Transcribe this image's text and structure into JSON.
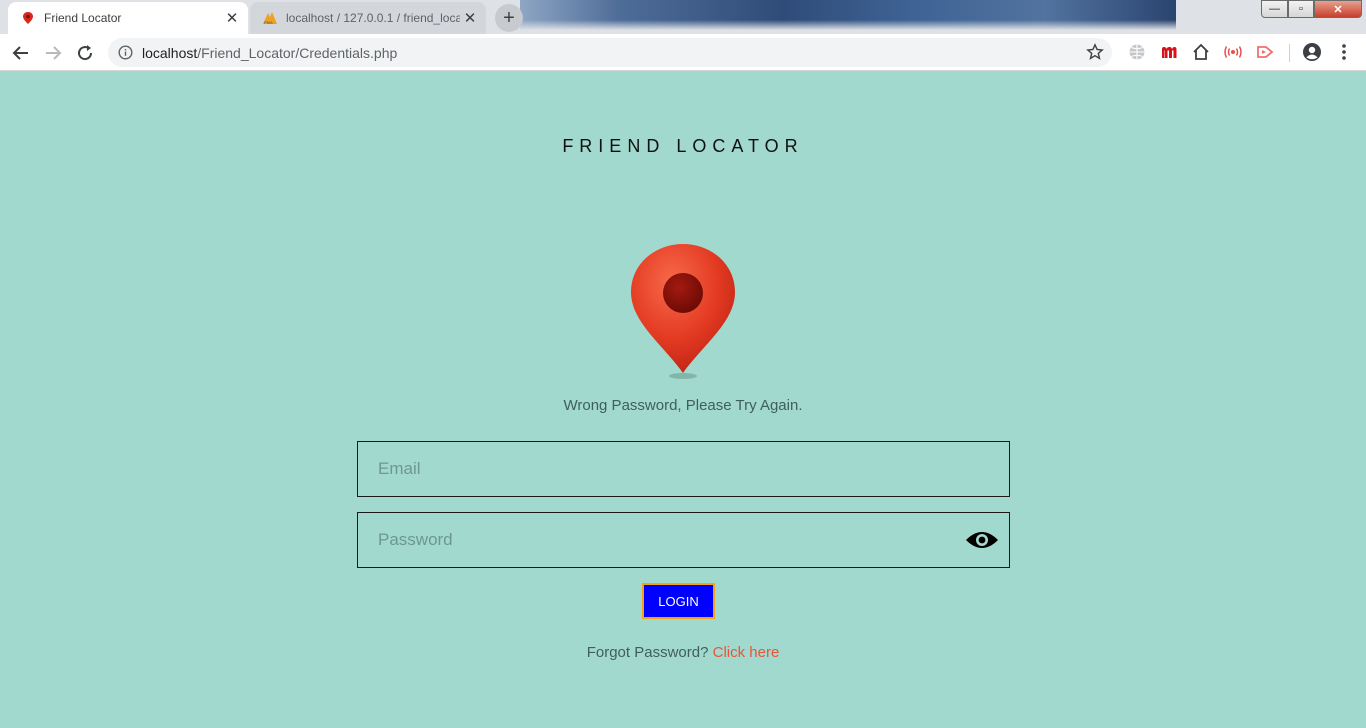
{
  "browser": {
    "tabs": [
      {
        "title": "Friend Locator",
        "active": true,
        "favicon": "map-pin-icon"
      },
      {
        "title": "localhost / 127.0.0.1 / friend_loca",
        "active": false,
        "favicon": "phpmyadmin-icon"
      }
    ],
    "new_tab_label": "+",
    "address": {
      "host": "localhost",
      "path": "/Friend_Locator/Credentials.php"
    },
    "window_controls": {
      "minimize": "—",
      "maximize": "▫",
      "close": "✕"
    }
  },
  "page": {
    "title": "FRIEND LOCATOR",
    "logo": "map-pin-icon",
    "error_message": "Wrong Password, Please Try Again.",
    "email": {
      "placeholder": "Email",
      "value": ""
    },
    "password": {
      "placeholder": "Password",
      "value": ""
    },
    "login_label": "LOGIN",
    "forgot_text": "Forgot Password?",
    "forgot_link": "Click here"
  },
  "colors": {
    "background": "#a2d9ce",
    "login_button": "#0000ff",
    "login_border": "#f4a21c",
    "link": "#e8553a",
    "pin_red": "#e53b24"
  }
}
